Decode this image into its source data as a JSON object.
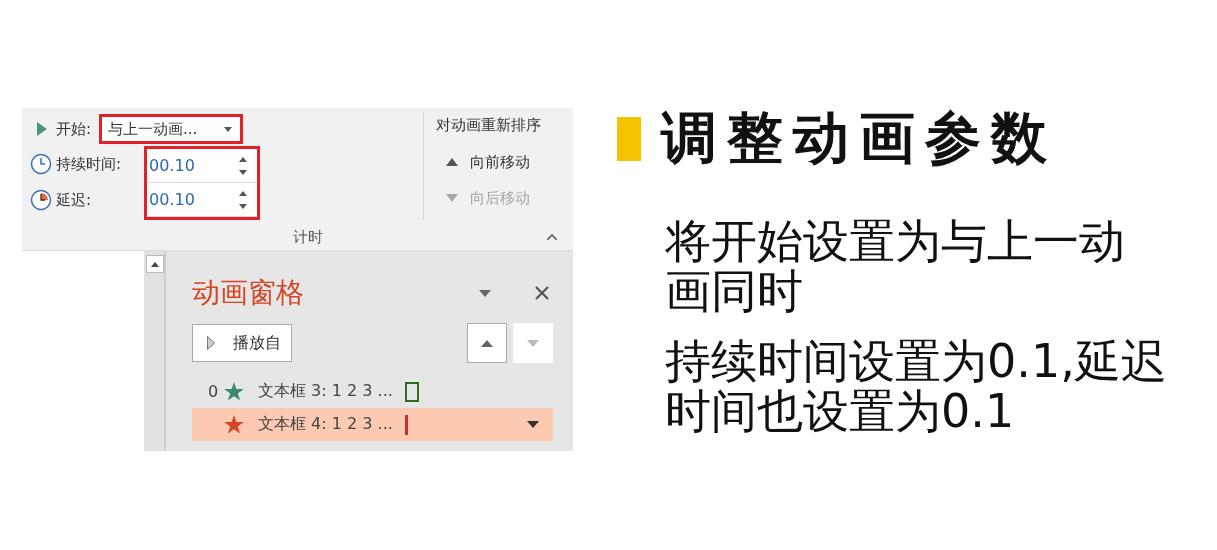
{
  "ribbon": {
    "start": {
      "label": "开始:",
      "value": "与上一动画...",
      "highlighted": true
    },
    "duration": {
      "label": "持续时间:",
      "value": "00.10"
    },
    "delay": {
      "label": "延迟:",
      "value": "00.10"
    },
    "timing_fields_highlighted": true,
    "reorder": {
      "title": "对动画重新排序",
      "actions": [
        {
          "label": "向前移动",
          "disabled": false
        },
        {
          "label": "向后移动",
          "disabled": true
        }
      ]
    },
    "group_label": "计时"
  },
  "animation_pane": {
    "title": "动画窗格",
    "play_button": "播放自",
    "items": [
      {
        "index": "0",
        "label": "文本框 3: 1 2 3 ...",
        "color": "#3c8a6e",
        "kind": "box",
        "selected": false
      },
      {
        "label": "文本框 4: 1 2 3 ...",
        "color": "#d24726",
        "kind": "line",
        "selected": true
      }
    ]
  },
  "notes": {
    "title": "调整动画参数",
    "paragraphs": [
      "将开始设置为与上一动画同时",
      "持续时间设置为0.1,延迟时间也设置为0.1"
    ]
  }
}
